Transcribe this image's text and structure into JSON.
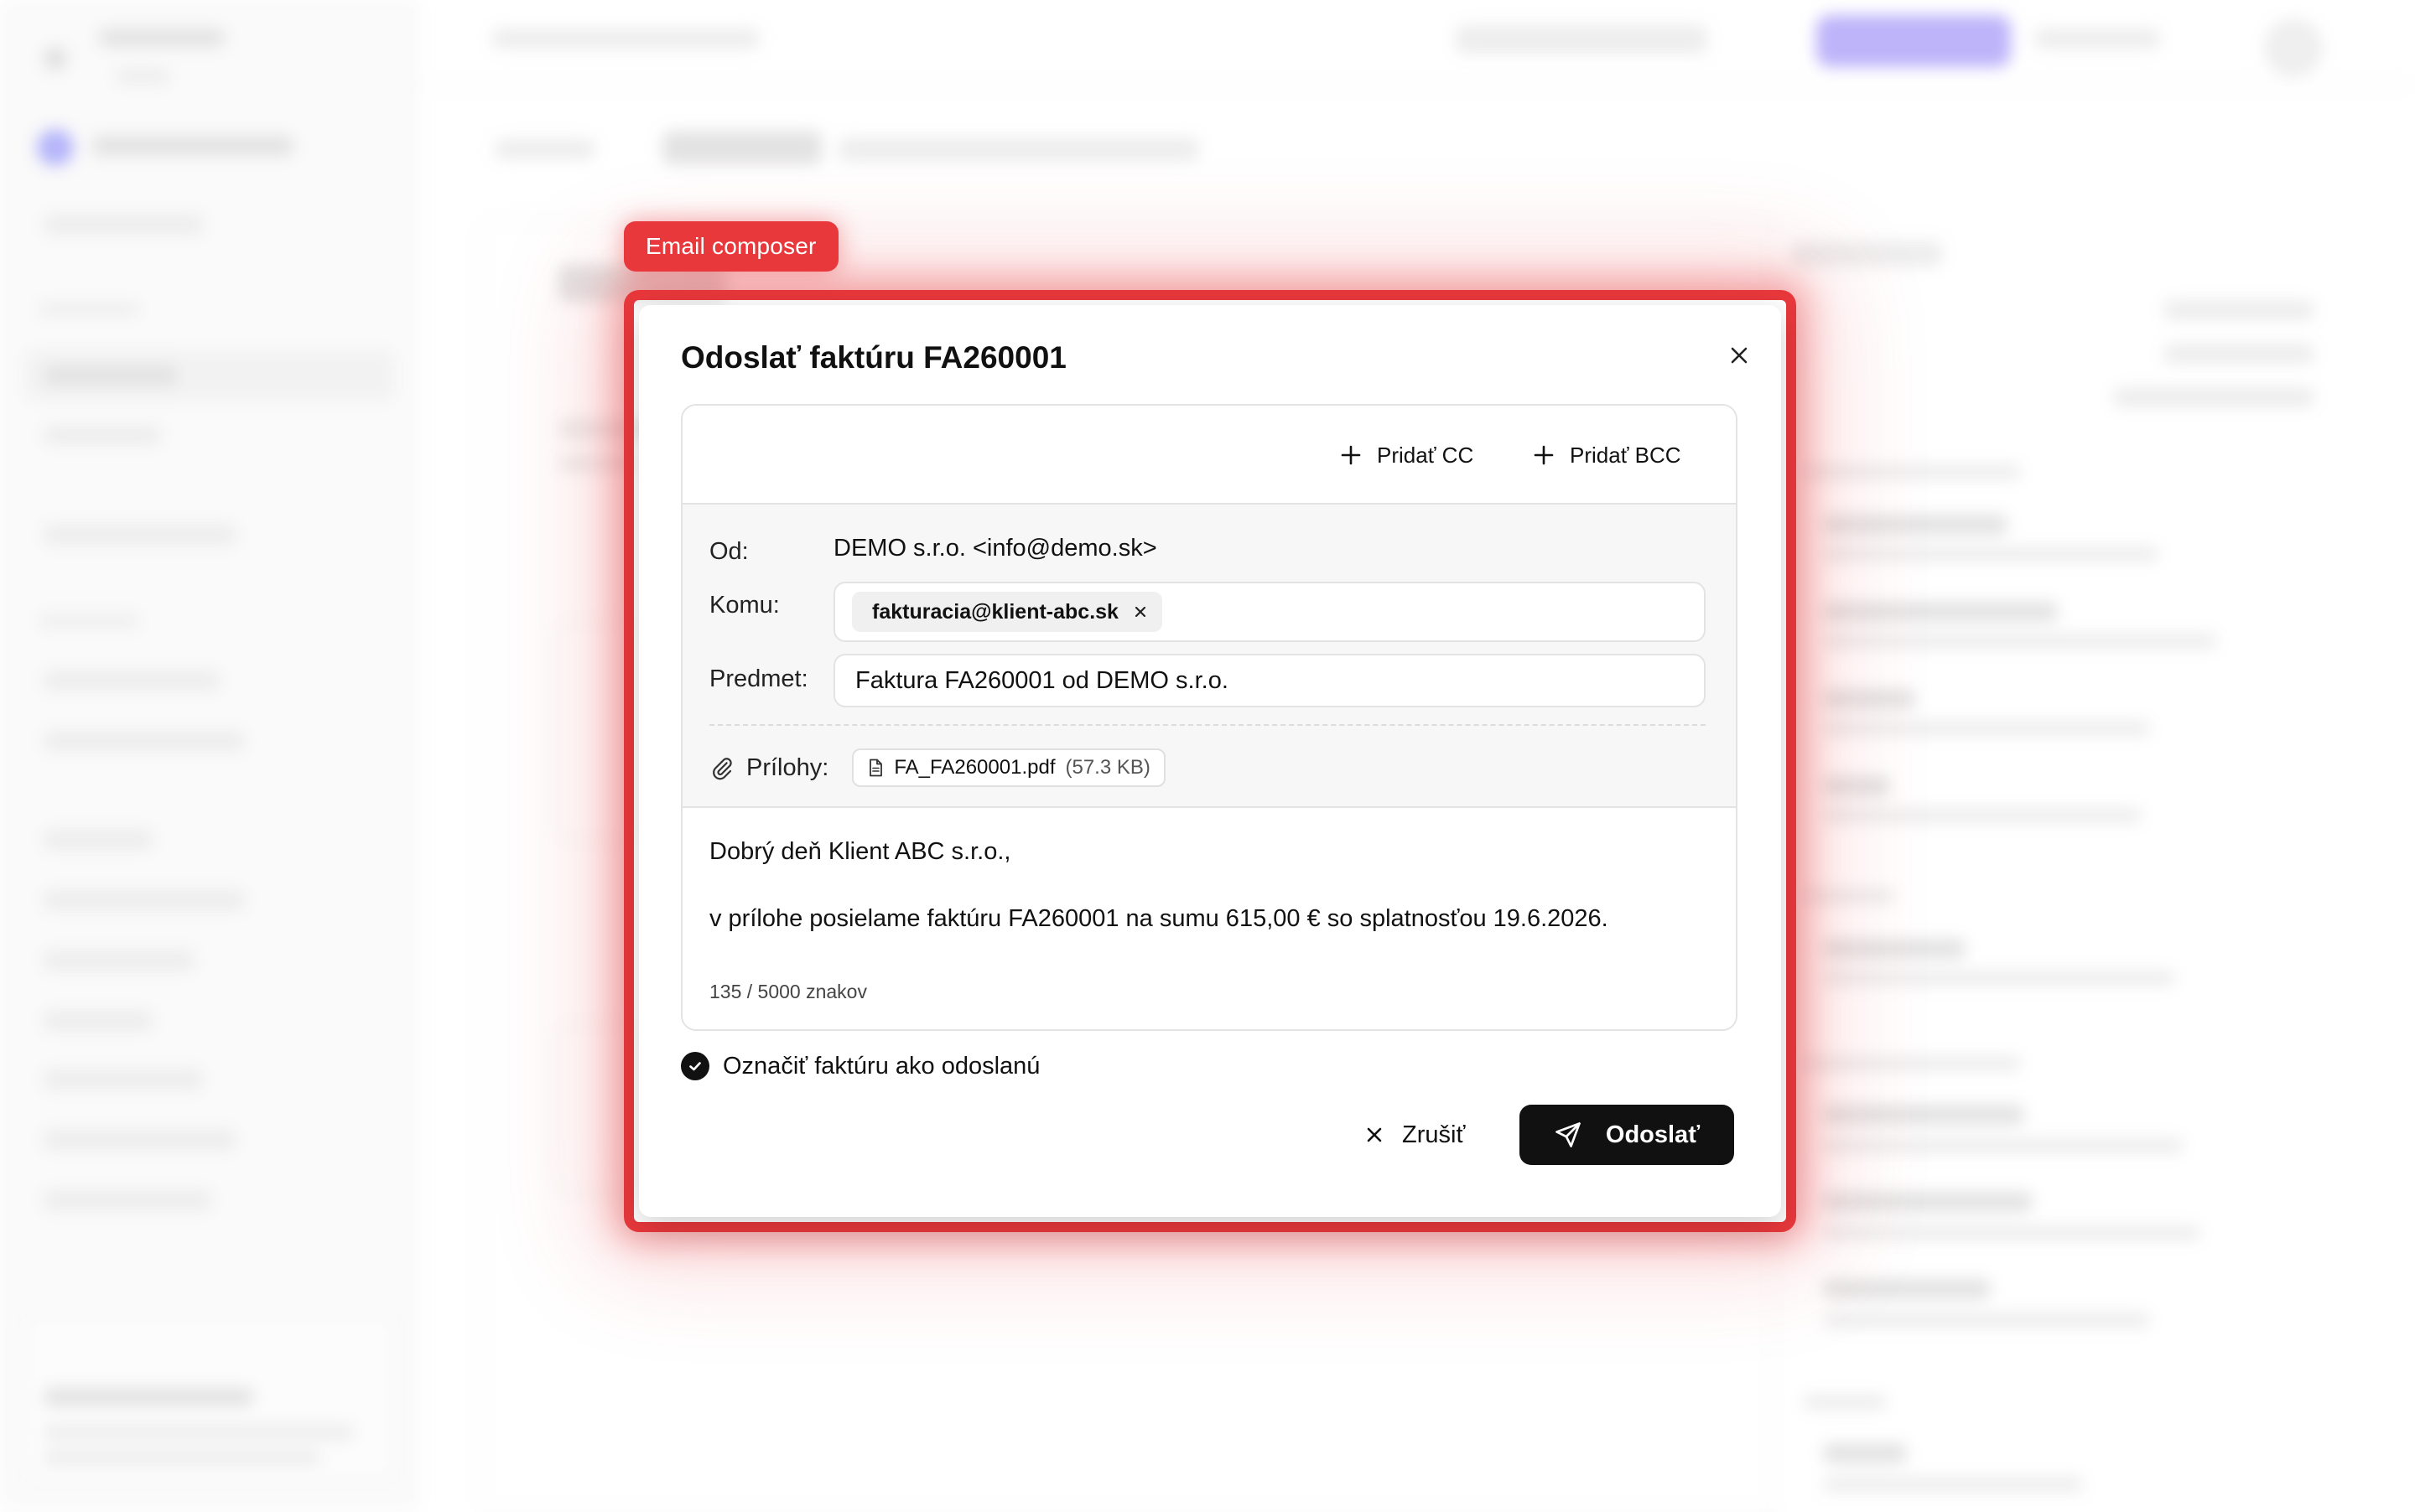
{
  "highlight": {
    "label": "Email composer",
    "color": "#e8383c"
  },
  "modal": {
    "title": "Odoslať faktúru FA260001",
    "close_icon": "close-icon",
    "add_cc_label": "Pridať CC",
    "add_bcc_label": "Pridať BCC",
    "from_label": "Od:",
    "from_value": "DEMO s.r.o. <info@demo.sk>",
    "to_label": "Komu:",
    "to_recipients": [
      "fakturacia@klient-abc.sk"
    ],
    "subject_label": "Predmet:",
    "subject_value": "Faktura FA260001 od DEMO s.r.o.",
    "attachments_label": "Prílohy:",
    "attachments": [
      {
        "name": "FA_FA260001.pdf",
        "size": "(57.3 KB)"
      }
    ],
    "body_lines": [
      "Dobrý deň Klient ABC s.r.o.,",
      "v prílohe posielame faktúru FA260001 na sumu 615,00 € so splatnosťou 19.6.2026."
    ],
    "char_counter": "135 / 5000 znakov",
    "mark_sent_label": "Označiť faktúru ako odoslanú",
    "mark_sent_checked": true,
    "cancel_label": "Zrušiť",
    "send_label": "Odoslať",
    "send_button_color": "#111111"
  }
}
